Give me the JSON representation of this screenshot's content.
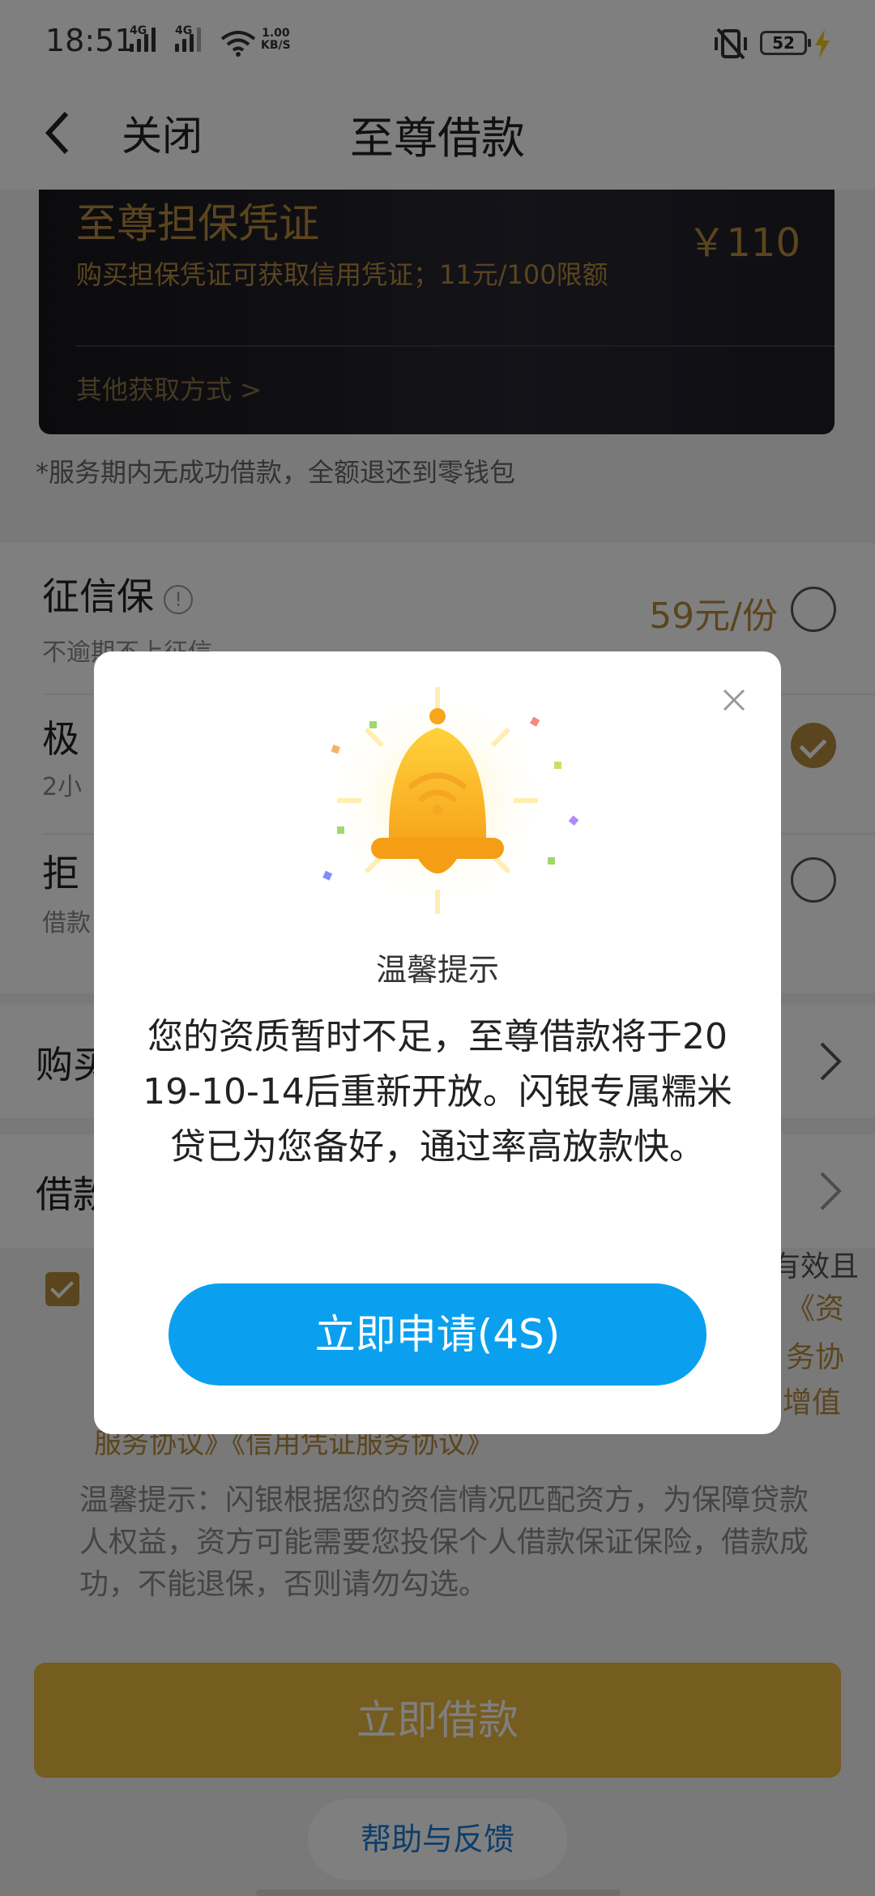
{
  "status_bar": {
    "time": "18:51",
    "network_1": "4G",
    "network_2": "4G",
    "speed_value": "1.00",
    "speed_unit": "KB/S",
    "battery": "52"
  },
  "nav": {
    "close_label": "关闭",
    "title": "至尊借款"
  },
  "voucher_card": {
    "title": "至尊担保凭证",
    "price": "￥110",
    "description": "购买担保凭证可获取信用凭证；11元/100限额",
    "other_ways": "其他获取方式 >"
  },
  "refund_note": "*服务期内无成功借款，全额退还到零钱包",
  "insurance": {
    "items": [
      {
        "title": "征信保",
        "subtitle": "不逾期不上征信",
        "price": "59元/份",
        "selected": false
      },
      {
        "title": "极",
        "subtitle": "2小",
        "price": "",
        "selected": true
      },
      {
        "title": "拒",
        "subtitle": "借款",
        "price": "",
        "selected": false
      }
    ]
  },
  "buy_row": {
    "label": "购买"
  },
  "loan_row": {
    "label": "借款"
  },
  "agreement": {
    "frag_1": "有效且",
    "frag_2": "《资",
    "frag_3": "务协",
    "frag_4": "增值",
    "line_bottom": "服务协议》《信用凭证服务协议》"
  },
  "tip": "温馨提示：闪银根据您的资信情况匹配资方，为保障贷款人权益，资方可能需要您投保个人借款保证保险，借款成功，不能退保，否则请勿勾选。",
  "main_button": "立即借款",
  "help_button": "帮助与反馈",
  "modal": {
    "title": "温馨提示",
    "message": "您的资质暂时不足，至尊借款将于2019-10-14后重新开放。闪银专属糯米贷已为您备好，通过率高放款快。",
    "button": "立即申请(4S)"
  },
  "colors": {
    "gold": "#b68a3d",
    "button_yellow": "#eab93f",
    "modal_button_blue": "#0aa0ef",
    "help_blue": "#1a7ad2"
  }
}
